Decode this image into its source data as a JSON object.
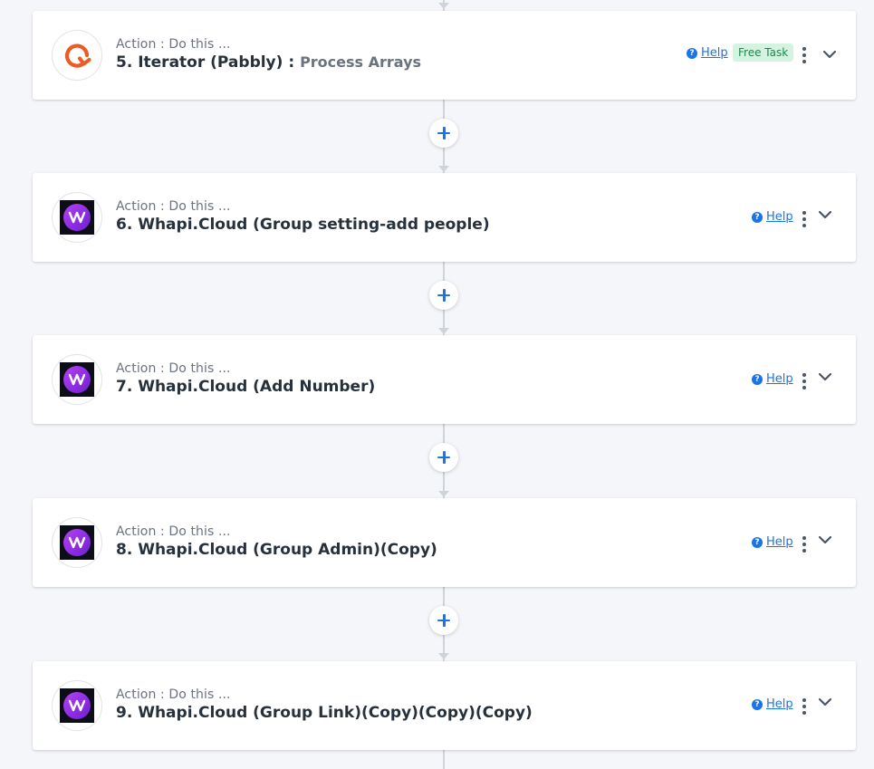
{
  "colors": {
    "background": "#f4f6f9",
    "accent": "#1a73e8",
    "connector": "#cfd4da",
    "badge_bg": "#d4f4e2",
    "badge_text": "#178a4c",
    "iterator_orange": "#ee5a24",
    "whapi_purple": "#9b35ea"
  },
  "steps": [
    {
      "label": "Action : Do this ...",
      "title": "5. Iterator (Pabbly) :",
      "event": "Process Arrays",
      "help": "Help",
      "badge": "Free Task",
      "icon": "iterator-icon"
    },
    {
      "label": "Action : Do this ...",
      "title": "6. Whapi.Cloud (Group setting-add people)",
      "help": "Help",
      "icon": "whapi-cloud-icon"
    },
    {
      "label": "Action : Do this ...",
      "title": "7. Whapi.Cloud (Add Number)",
      "help": "Help",
      "icon": "whapi-cloud-icon"
    },
    {
      "label": "Action : Do this ...",
      "title": "8. Whapi.Cloud (Group Admin)(Copy)",
      "help": "Help",
      "icon": "whapi-cloud-icon"
    },
    {
      "label": "Action : Do this ...",
      "title": "9. Whapi.Cloud (Group Link)(Copy)(Copy)(Copy)",
      "help": "Help",
      "icon": "whapi-cloud-icon"
    }
  ],
  "icons": {
    "add": "plus-icon",
    "help": "question-circle-icon",
    "more": "vertical-dots-icon",
    "expand": "chevron-down-icon"
  }
}
